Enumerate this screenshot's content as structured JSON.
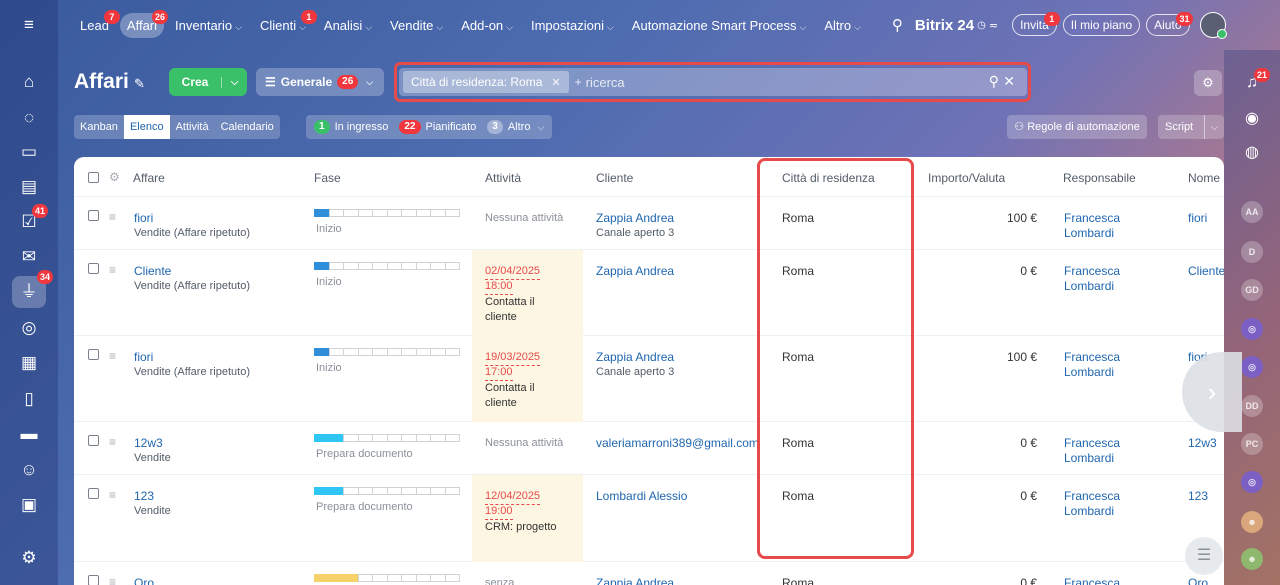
{
  "nav": {
    "items": [
      {
        "label": "Lead",
        "badge": "7",
        "chevron": false,
        "active": false
      },
      {
        "label": "Affari",
        "badge": "26",
        "chevron": false,
        "active": true
      },
      {
        "label": "Inventario",
        "badge": "",
        "chevron": true,
        "active": false
      },
      {
        "label": "Clienti",
        "badge": "1",
        "chevron": true,
        "active": false
      },
      {
        "label": "Analisi",
        "badge": "",
        "chevron": true,
        "active": false
      },
      {
        "label": "Vendite",
        "badge": "",
        "chevron": true,
        "active": false
      },
      {
        "label": "Add-on",
        "badge": "",
        "chevron": true,
        "active": false
      },
      {
        "label": "Impostazioni",
        "badge": "",
        "chevron": true,
        "active": false
      },
      {
        "label": "Automazione Smart Process",
        "badge": "",
        "chevron": true,
        "active": false
      },
      {
        "label": "Altro",
        "badge": "",
        "chevron": true,
        "active": false
      }
    ],
    "brand": "Bitrix 24",
    "invite_label": "Invita",
    "invite_badge": "1",
    "plan_label": "Il mio piano",
    "help_label": "Aiuto",
    "help_badge": "31"
  },
  "leftbar": {
    "badges": {
      "tasks": "41",
      "crm": "34"
    }
  },
  "rightbar": {
    "notif_badge": "21",
    "avatars": [
      "AA",
      "D",
      "GD",
      "",
      "",
      "DD",
      "PC",
      ""
    ]
  },
  "header": {
    "title": "Affari",
    "create_label": "Crea",
    "pipeline_label": "Generale",
    "pipeline_badge": "26"
  },
  "search": {
    "chip": "Città di residenza: Roma",
    "placeholder": "ricerca"
  },
  "views": {
    "tabs": [
      "Kanban",
      "Elenco",
      "Attività",
      "Calendario"
    ],
    "active": "Elenco"
  },
  "counters": [
    {
      "count": "1",
      "label": "In ingresso",
      "color": "green"
    },
    {
      "count": "22",
      "label": "Pianificato",
      "color": "red"
    },
    {
      "count": "3",
      "label": "Altro",
      "color": "gray"
    }
  ],
  "toolbar": {
    "rules_label": "Regole di automazione",
    "script_label": "Script"
  },
  "table": {
    "columns": [
      "Affare",
      "Fase",
      "Attività",
      "Cliente",
      "Città di residenza",
      "Importo/Valuta",
      "Responsabile",
      "Nome"
    ],
    "rows": [
      {
        "deal": "fiori",
        "pipeline": "Vendite (Affare ripetuto)",
        "stage": "Inizio",
        "stage_level": 1,
        "stage_color": "#2f8fdb",
        "activity_date": "",
        "activity_time": "",
        "activity_text": "Nessuna attività",
        "client": "Zappia Andrea",
        "client_sub": "Canale aperto 3",
        "city": "Roma",
        "amount": "100 €",
        "responsible": "Francesca Lombardi",
        "name": "fiori"
      },
      {
        "deal": "Cliente",
        "pipeline": "Vendite (Affare ripetuto)",
        "stage": "Inizio",
        "stage_level": 1,
        "stage_color": "#2f8fdb",
        "activity_date": "02/04/2025",
        "activity_time": "18:00",
        "activity_text": "Contatta il cliente",
        "client": "Zappia Andrea",
        "client_sub": "",
        "city": "Roma",
        "amount": "0 €",
        "responsible": "Francesca Lombardi",
        "name": "Cliente"
      },
      {
        "deal": "fiori",
        "pipeline": "Vendite (Affare ripetuto)",
        "stage": "Inizio",
        "stage_level": 1,
        "stage_color": "#2f8fdb",
        "activity_date": "19/03/2025",
        "activity_time": "17:00",
        "activity_text": "Contatta il cliente",
        "client": "Zappia Andrea",
        "client_sub": "Canale aperto 3",
        "city": "Roma",
        "amount": "100 €",
        "responsible": "Francesca Lombardi",
        "name": "fiori"
      },
      {
        "deal": "12w3",
        "pipeline": "Vendite",
        "stage": "Prepara documento",
        "stage_level": 2,
        "stage_color": "#2fc6f6",
        "activity_date": "",
        "activity_time": "",
        "activity_text": "Nessuna attività",
        "client": "valeriamarroni389@gmail.com",
        "client_sub": "",
        "city": "Roma",
        "amount": "0 €",
        "responsible": "Francesca Lombardi",
        "name": "12w3"
      },
      {
        "deal": "123",
        "pipeline": "Vendite",
        "stage": "Prepara documento",
        "stage_level": 2,
        "stage_color": "#2fc6f6",
        "activity_date": "12/04/2025",
        "activity_time": "19:00",
        "activity_text": "CRM: progetto",
        "client": "Lombardi Alessio",
        "client_sub": "",
        "city": "Roma",
        "amount": "0 €",
        "responsible": "Francesca Lombardi",
        "name": "123"
      },
      {
        "deal": "Oro",
        "pipeline": "",
        "stage": "",
        "stage_level": 3,
        "stage_color": "#f7d26b",
        "activity_date": "",
        "activity_time": "",
        "activity_text": "senza",
        "client": "Zappia Andrea",
        "client_sub": "",
        "city": "Roma",
        "amount": "0 €",
        "responsible": "Francesca",
        "name": "Oro"
      }
    ]
  }
}
